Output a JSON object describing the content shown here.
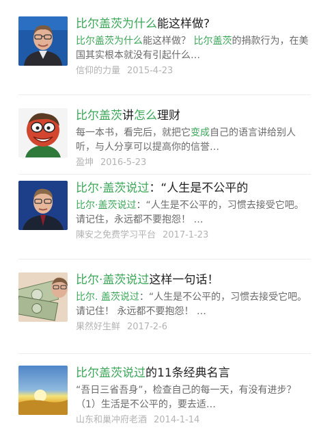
{
  "results": [
    {
      "title": [
        {
          "text": "比尔盖茨为什么",
          "hl": true
        },
        {
          "text": "能这样做?",
          "hl": false
        }
      ],
      "snippet": [
        {
          "text": "比尔盖茨为什么",
          "hl": true
        },
        {
          "text": "能这样做？ ",
          "hl": false
        },
        {
          "text": "比尔盖茨",
          "hl": true
        },
        {
          "text": "的捐款行为，在美国其实根本就没有引起什么…",
          "hl": false
        }
      ],
      "source": "信仰的力量",
      "date": "2015-4-23",
      "thumb": "bill-gates-photo"
    },
    {
      "title": [
        {
          "text": "比尔盖茨",
          "hl": true
        },
        {
          "text": "讲",
          "hl": false
        },
        {
          "text": "怎么",
          "hl": true
        },
        {
          "text": "理财",
          "hl": false
        }
      ],
      "snippet": [
        {
          "text": "每一本书，看完后，就把它",
          "hl": false
        },
        {
          "text": "变成",
          "hl": true
        },
        {
          "text": "自己的语言讲给别人听，与人分享可以提高你的信誉…",
          "hl": false
        }
      ],
      "source": "盈坤",
      "date": "2016-5-23",
      "thumb": "bill-gates-caricature"
    },
    {
      "title": [
        {
          "text": "比尔·盖茨说过",
          "hl": true
        },
        {
          "text": "：“人生是不公平的",
          "hl": false
        }
      ],
      "snippet": [
        {
          "text": "比尔·盖茨说过",
          "hl": true
        },
        {
          "text": "：“人生是不公平的，习惯去接受它吧。 请记住，永远都不要抱怨！ …",
          "hl": false
        }
      ],
      "source": "陳安之免费学习平台",
      "date": "2017-1-23",
      "thumb": "bill-gates-portrait"
    },
    {
      "title": [
        {
          "text": "比尔·盖茨说过",
          "hl": true
        },
        {
          "text": "这样一句话！",
          "hl": false
        }
      ],
      "snippet": [
        {
          "text": "比尔. 盖茨说过",
          "hl": true
        },
        {
          "text": "：“人生是不公平的，习惯去接受它吧。 请记住！ 永远都不要抱怨！ …",
          "hl": false
        }
      ],
      "source": "果然好生鲜",
      "date": "2017-2-6",
      "thumb": "money-and-gates"
    },
    {
      "title": [
        {
          "text": "比尔盖茨说过",
          "hl": true
        },
        {
          "text": "的11条经典名言",
          "hl": false
        }
      ],
      "snippet": [
        {
          "text": "“吾日三省吾身”，检查自己的每一天，有没有进步？ （1）生活是不公平的，要去适…",
          "hl": false
        }
      ],
      "source": "山东和巢冲府老酒",
      "date": "2014-1-14",
      "thumb": "sunset-field"
    }
  ]
}
